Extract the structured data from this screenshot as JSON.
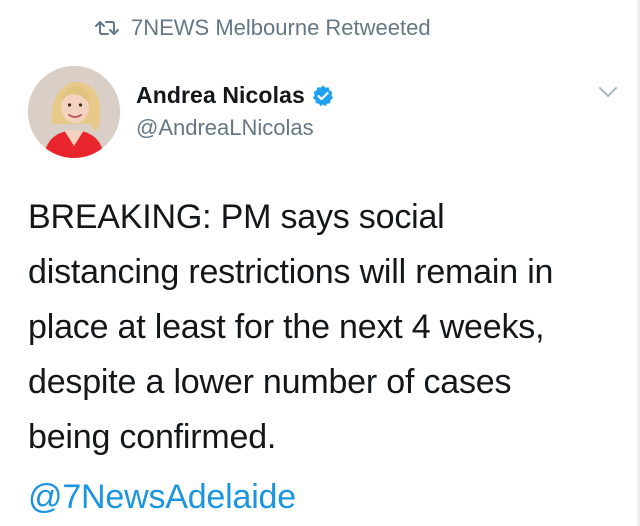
{
  "retweet": {
    "icon": "retweet-icon",
    "label": "7NEWS Melbourne Retweeted"
  },
  "author": {
    "display_name": "Andrea Nicolas",
    "handle": "@AndreaLNicolas",
    "verified_icon": "verified-badge-icon",
    "avatar": "avatar"
  },
  "menu": {
    "icon": "chevron-down-icon"
  },
  "tweet": {
    "lines": [
      "BREAKING: PM says social",
      "distancing restrictions will remain in",
      "place at least for the next 4 weeks,",
      "despite a lower number of cases",
      "being confirmed."
    ],
    "mention": "@7NewsAdelaide"
  },
  "colors": {
    "text": "#14171a",
    "secondary": "#657786",
    "link": "#1b95e0",
    "verified": "#1da1f2"
  }
}
